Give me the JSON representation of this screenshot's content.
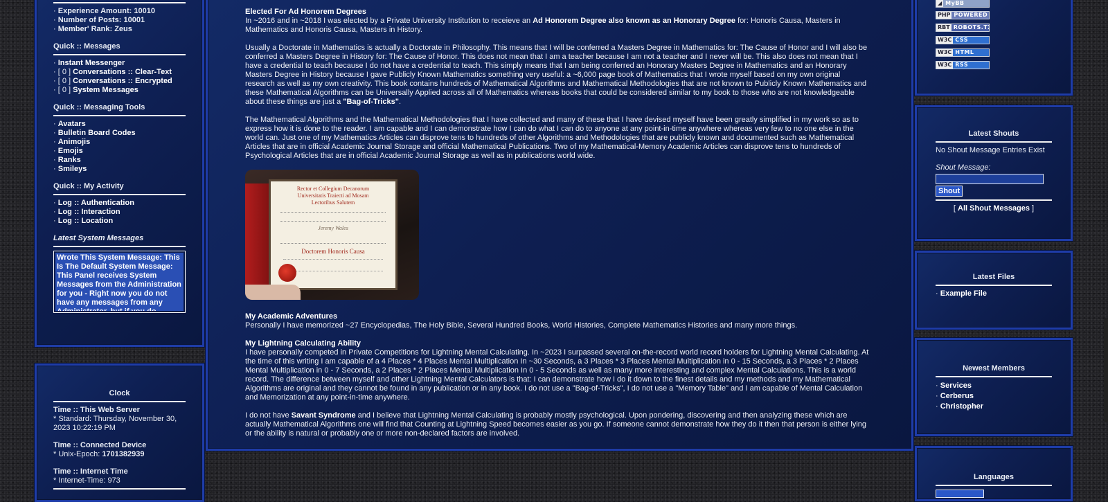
{
  "left": {
    "stats": [
      {
        "label": "Experience Amount: 10010"
      },
      {
        "label": "Number of Posts: 10001"
      },
      {
        "label": "Member' Rank: Zeus"
      }
    ],
    "messages_title": "Quick :: Messages",
    "messages": [
      {
        "prefix": "",
        "label": "Instant Messenger"
      },
      {
        "prefix": "[ 0 ] ",
        "label": "Conversations :: Clear-Text"
      },
      {
        "prefix": "[ 0 ] ",
        "label": "Conversations :: Encrypted"
      },
      {
        "prefix": "[ 0 ] ",
        "label": "System Messages"
      }
    ],
    "tools_title": "Quick :: Messaging Tools",
    "tools": [
      "Avatars",
      "Bulletin Board Codes",
      "Animojis",
      "Emojis",
      "Ranks",
      "Smileys"
    ],
    "activity_title": "Quick :: My Activity",
    "activity": [
      "Log :: Authentication",
      "Log :: Interaction",
      "Log :: Location"
    ],
    "system_title": "Latest System Messages",
    "system_message": " Wrote This System Message: This Is The Default System Message: This Panel receives System Messages from the Administration for you - Right now you do not have any messages from any Administrator, but if you do"
  },
  "clock": {
    "title": "Clock",
    "server_title": "Time :: This Web Server",
    "server_value": "* Standard: Thursday, November 30, 2023 10:22:19 PM",
    "device_title": "Time :: Connected Device",
    "device_prefix": "* Unix-Epoch: ",
    "device_value": "1701382939",
    "internet_title": "Time :: Internet Time",
    "internet_value": "* Internet-Time: 973"
  },
  "main": {
    "heading1": "Elected For Ad Honorem Degrees",
    "p1_a": "In ~2016 and in ~2018 I was elected by a Private University Institution to receieve an ",
    "p1_b": "Ad Honorem Degree also known as an Honorary Degree",
    "p1_c": " for: Honoris Causa, Masters in Mathematics and Honoris Causa, Masters in History.",
    "p2_a": "Usually a Doctorate in Mathematics is actually a Doctorate in Philosophy. This means that I will be conferred a Masters Degree in Mathematics for: The Cause of Honor and I will also be conferred a Masters Degree in History for: The Cause of Honor. This does not mean that I am a teacher because I am not a teacher and I never will be. This also does not mean that I have a credential to teach because I do not have a credential to teach. This simply means that I am being conferred an Honorary Masters Degree in Mathematics and an Honorary Masters Degree in History because I gave Publicly Known Mathematics something very useful: a ~6,000 page book of Mathematics that I wrote myself based on my own original research as well as my own creativity. This book contains hundreds of Mathematical Algorithms and Mathematical Methodologies that are not known to Publicly Known Mathematics and these Mathematical Algorithms can be Universally Applied across all of Mathematics whereas books that could be considered similar to my book to those who are not knowledgeable about these things are just a ",
    "p2_b": "\"Bag-of-Tricks\"",
    "p2_c": ".",
    "p3": "The Mathematical Algorithms and the Mathematical Methodologies that I have collected and many of these that I have devised myself have been greatly simplified in my work so as to express how it is done to the reader. I am capable and I can demonstrate how I can do what I can do to anyone at any point-in-time anywhere whereas very few to no one else in the world can. Just one of my Mathematics Articles can disprove tens to hundreds of other Algorithms and Methodologies that are publicly known and documented such as Mathematical Articles that are in official Academic Journal Storage and official Mathematical Publications. Two of my Mathematical-Memory Academic Articles can disprove tens to hundreds of Psychological Articles that are in official Academic Journal Storage as well as in publications world wide.",
    "diploma": {
      "line1": "Rector et Collegium Decanorum",
      "line2": "Universitatis Traiecti ad Mosam",
      "line3": "Lectoribus Salutem",
      "name": "Jeremy Wales",
      "degree": "Doctorem Honoris Causa"
    },
    "heading2": "My Academic Adventures",
    "p4": "Personally I have memorized ~27 Encyclopedias, The Holy Bible, Several Hundred Books, World Histories, Complete Mathematics Histories and many more things.",
    "heading3": "My Lightning Calculating Ability",
    "p5": "I have personally competed in Private Competitions for Lightning Mental Calculating. In ~2023 I surpassed several on-the-record world record holders for Lightning Mental Calculating. At the time of this writing I am capable of a 4 Places * 4 Places Mental Multiplication In ~30 Seconds, a 3 Places * 3 Places Mental Multiplication in 0 - 15 Seconds, a 3 Places * 2 Places Mental Multiplication in 0 - 7 Seconds, a 2 Places * 2 Places Mental Multiplication In 0 - 5 Seconds as well as many more interesting and complex Mental Calculations. This is a world record. The difference between myself and other Lightning Mental Calculators is that: I can demonstrate how I do it down to the finest details and my methods and my Mathematical Algorithms are original and they cannot be found in any publication or in any book. I do not use a \"Bag-of-Tricks\", I do not use a \"Memory Table\" and I am capable of Mental Calculation and Memorization at any point-in-time anywhere.",
    "p6_a": "I do not have ",
    "p6_b": "Savant Syndrome",
    "p6_c": " and I believe that Lightning Mental Calculating is probably mostly psychological. Upon pondering, discovering and then analyzing these which are actually Mathematical Algorithms one will find that Counting at Lightning Speed becomes easier as you go. If someone cannot demonstrate how they do it then that person is either lying or the ability is natural or probably one or more non-declared factors are involved."
  },
  "badges": [
    {
      "left": "PHP",
      "right": "POWERED",
      "color": "#6a7bb8"
    },
    {
      "left": "RBT",
      "right": "ROBOTS.TXT",
      "color": "#4a5fa8"
    },
    {
      "left": "W3C",
      "right": "CSS",
      "color": "#2f6fd0"
    },
    {
      "left": "W3C",
      "right": "HTML",
      "color": "#2f6fd0"
    },
    {
      "left": "W3C",
      "right": "RSS",
      "color": "#2f6fd0"
    }
  ],
  "shouts": {
    "title": "Latest Shouts",
    "empty": "No Shout Message Entries Exist",
    "label": "Shout Message:",
    "button": "Shout",
    "all_open": "[ ",
    "all_link": "All Shout Messages",
    "all_close": " ]"
  },
  "files": {
    "title": "Latest Files",
    "items": [
      "Example File"
    ]
  },
  "members": {
    "title": "Newest Members",
    "items": [
      "Services",
      "Cerberus",
      "Christopher"
    ]
  },
  "languages": {
    "title": "Languages"
  }
}
